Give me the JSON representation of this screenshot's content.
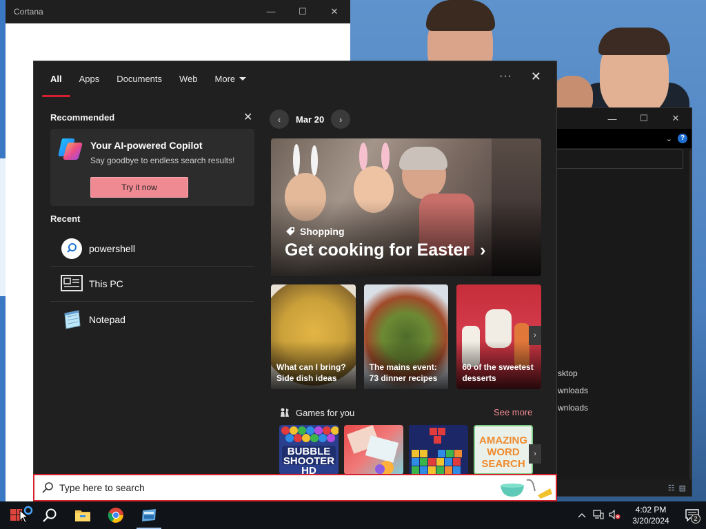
{
  "cortana": {
    "title": "Cortana",
    "controls": [
      "—",
      "☐",
      "✕"
    ]
  },
  "explorer": {
    "controls": [
      "—",
      "☐",
      "✕"
    ],
    "items": [
      "sktop",
      "wnloads",
      "wnloads"
    ]
  },
  "search_panel": {
    "tabs": [
      {
        "label": "All"
      },
      {
        "label": "Apps"
      },
      {
        "label": "Documents"
      },
      {
        "label": "Web"
      },
      {
        "label": "More"
      }
    ],
    "more_options": "···",
    "close": "✕"
  },
  "recommended": {
    "heading": "Recommended",
    "dismiss": "✕",
    "copilot": {
      "title": "Your AI-powered Copilot",
      "subtitle": "Say goodbye to endless search results!",
      "button": "Try it now"
    }
  },
  "recent": {
    "heading": "Recent",
    "items": [
      {
        "label": "powershell",
        "icon": "search-icon"
      },
      {
        "label": "This PC",
        "icon": "this-pc-icon"
      },
      {
        "label": "Notepad",
        "icon": "notepad-icon"
      }
    ]
  },
  "highlights": {
    "date": "Mar 20",
    "prev": "‹",
    "next": "›",
    "hero": {
      "tag": "Shopping",
      "title": "Get cooking for Easter",
      "chevron": "›"
    },
    "tiles": [
      {
        "label": "What can I bring? Side dish ideas"
      },
      {
        "label": "The mains event: 73 dinner recipes"
      },
      {
        "label": "60 of the sweetest desserts"
      }
    ],
    "tiles_next": "›"
  },
  "games": {
    "heading": "Games for you",
    "see_more": "See more",
    "items": [
      {
        "name": "BUBBLE SHOOTER HD"
      },
      {
        "name": "puzzle game"
      },
      {
        "name": "block puzzle"
      },
      {
        "name": "AMAZING WORD SEARCH"
      }
    ],
    "next": "›"
  },
  "searchbox": {
    "placeholder": "Type here to search"
  },
  "taskbar": {
    "clock_time": "4:02 PM",
    "clock_date": "3/20/2024",
    "notification_count": "2"
  },
  "colors": {
    "accent": "#d4232e",
    "copilot_button": "#f08a92",
    "panel_bg": "#202020"
  }
}
